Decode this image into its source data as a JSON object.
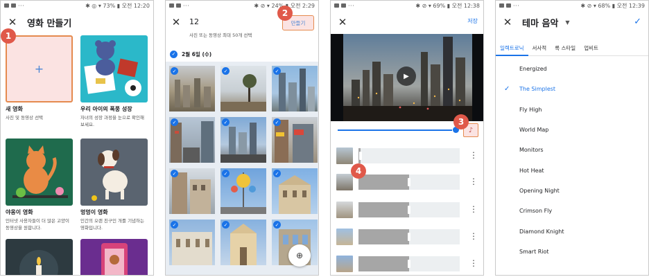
{
  "colors": {
    "accent": "#1a73e8",
    "marker": "#e0594a",
    "highlight_border": "#e58a4e",
    "highlight_fill": "#fbe3e2"
  },
  "markers": [
    "1",
    "2",
    "3",
    "4"
  ],
  "panel1": {
    "status": {
      "battery": "73%",
      "time": "오전 12:20"
    },
    "title": "영화 만들기",
    "cards": [
      {
        "title": "새 영화",
        "desc": "사진 및 동영상 선택"
      },
      {
        "title": "우리 아이의 폭풍 성장",
        "desc": "자녀의 성장 과정을 눈으로 확인해 보세요."
      },
      {
        "title": "야옹이 영화",
        "desc": "인터넷 사용자들이 더 많은 고양이 동영상을 원합니다."
      },
      {
        "title": "멍멍이 영화",
        "desc": "인간의 오랜 친구인 개를 기념하는 영화입니다."
      }
    ]
  },
  "panel2": {
    "status": {
      "battery": "24%",
      "time": "오전 2:29"
    },
    "count": "12",
    "subtitle": "사진 또는 동영상 최대 50개 선택",
    "make_label": "만들기",
    "date_label": "2월 6일 (수)"
  },
  "panel3": {
    "status": {
      "battery": "69%",
      "time": "오전 12:38"
    },
    "save_label": "저장",
    "progress": 0.97,
    "clips": [
      {
        "fill": 0.02
      },
      {
        "fill": 0.5
      },
      {
        "fill": 0.5
      },
      {
        "fill": 0.5
      },
      {
        "fill": 0.5
      }
    ]
  },
  "panel4": {
    "status": {
      "battery": "68%",
      "time": "오전 12:39"
    },
    "title": "테마 음악",
    "tabs": [
      "일렉트로닉",
      "서사적",
      "록 스타일",
      "업비트"
    ],
    "active_tab": 0,
    "tracks": [
      "Energized",
      "The Simplest",
      "Fly High",
      "World Map",
      "Monitors",
      "Hot Heat",
      "Opening Night",
      "Crimson Fly",
      "Diamond Knight",
      "Smart Riot"
    ],
    "selected_track": 1
  }
}
